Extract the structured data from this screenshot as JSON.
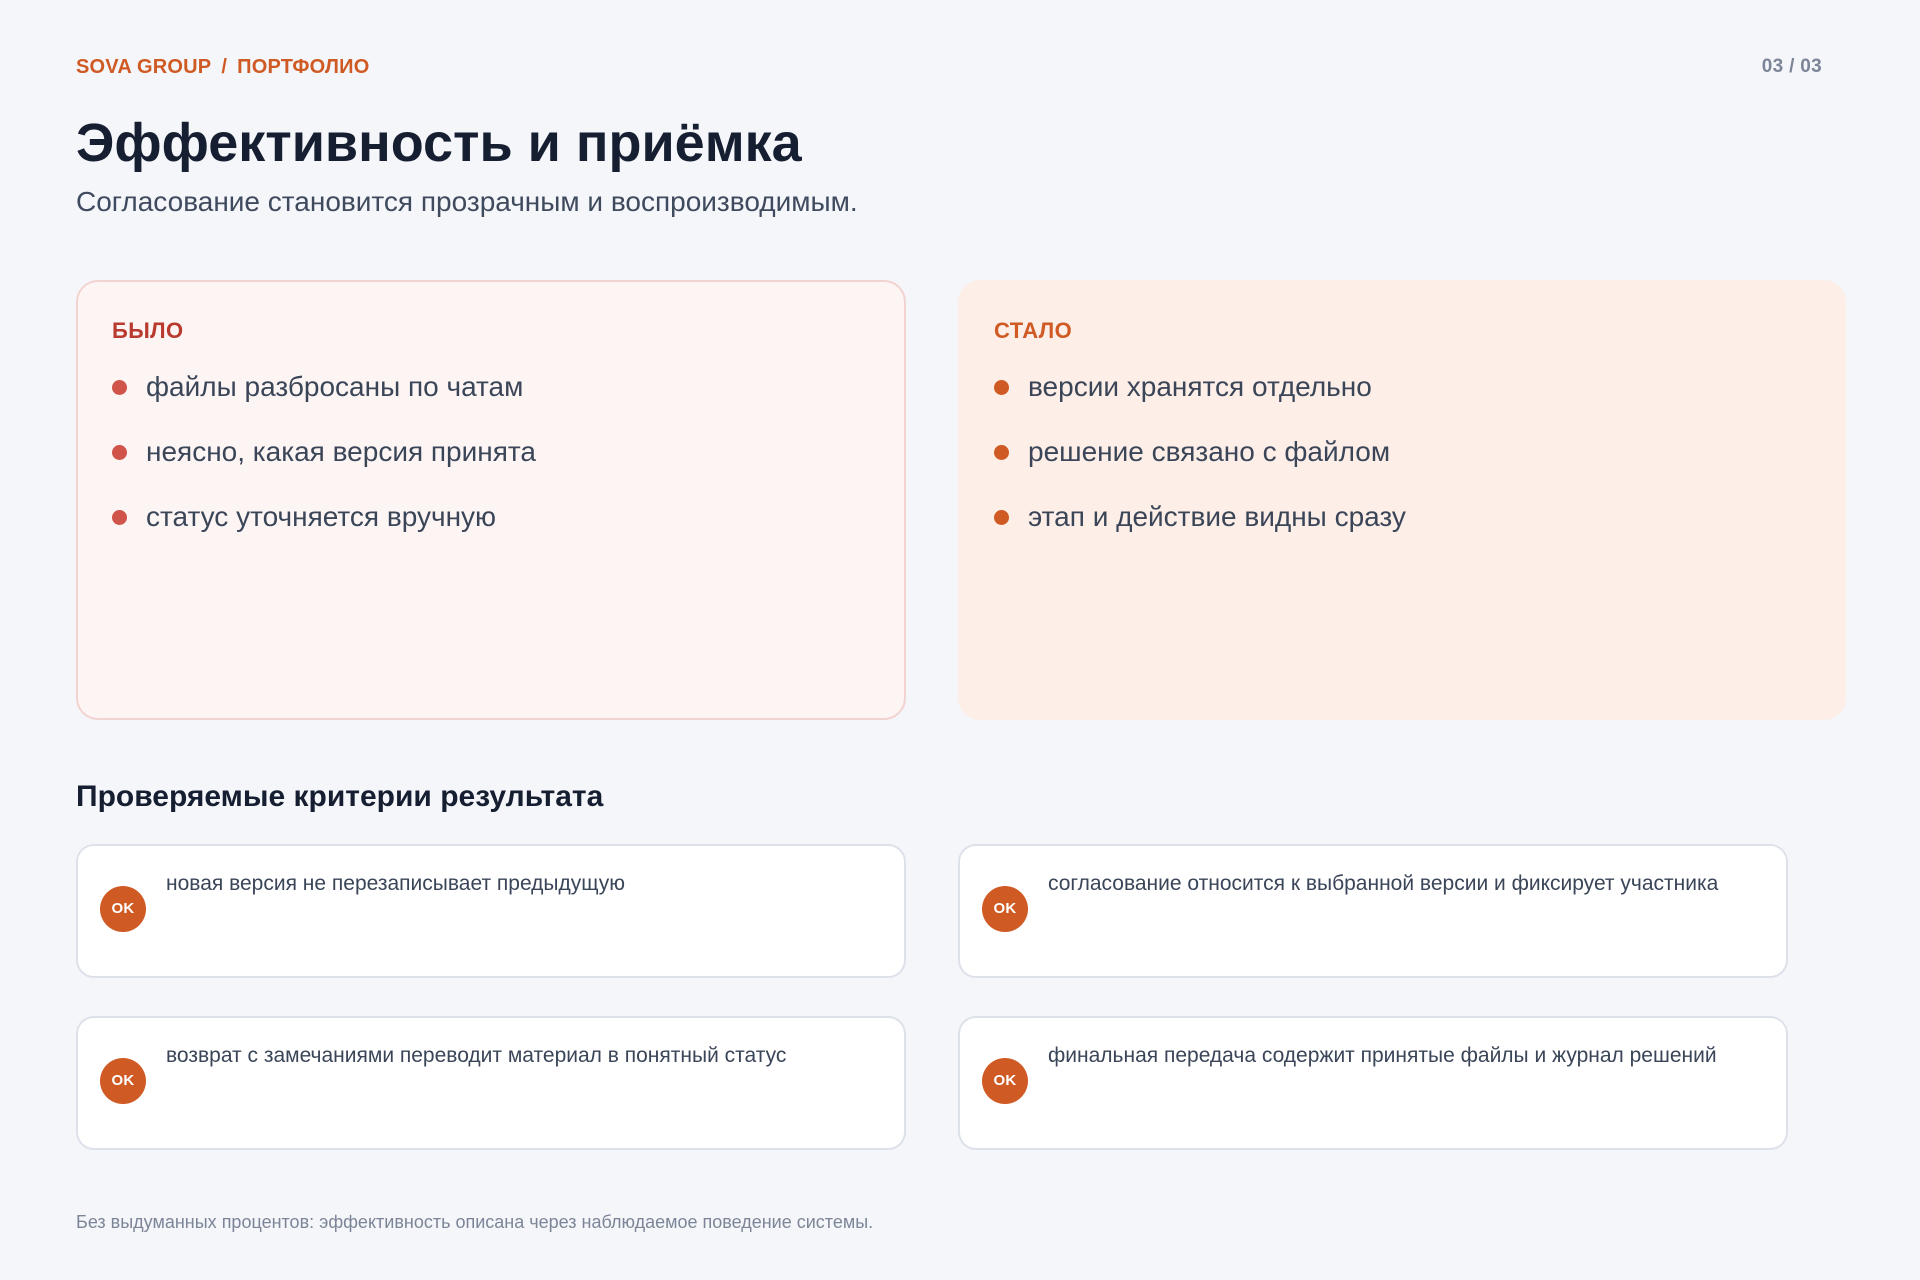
{
  "header": {
    "brand": "SOVA GROUP",
    "separator": "/",
    "section": "ПОРТФОЛИО",
    "page_counter": "03 / 03"
  },
  "title": "Эффективность и приёмка",
  "subtitle": "Согласование становится прозрачным и воспроизводимым.",
  "comparison": {
    "before": {
      "label": "БЫЛО",
      "items": [
        "файлы разбросаны по чатам",
        "неясно, какая версия принята",
        "статус уточняется вручную"
      ]
    },
    "after": {
      "label": "СТАЛО",
      "items": [
        "версии хранятся отдельно",
        "решение связано с файлом",
        "этап и действие видны сразу"
      ]
    }
  },
  "criteria": {
    "heading": "Проверяемые критерии результата",
    "badge_label": "OK",
    "items": [
      "новая версия не перезаписывает предыдущую",
      "согласование относится к выбранной версии и фиксирует участника",
      "возврат с замечаниями переводит материал в понятный статус",
      "финальная передача содержит принятые файлы и журнал решений"
    ]
  },
  "footnote": "Без выдуманных процентов: эффективность описана через наблюдаемое поведение системы.",
  "colors": {
    "accent": "#cf5a24",
    "before_accent": "#b93a2e",
    "background": "#f5f6fa"
  }
}
